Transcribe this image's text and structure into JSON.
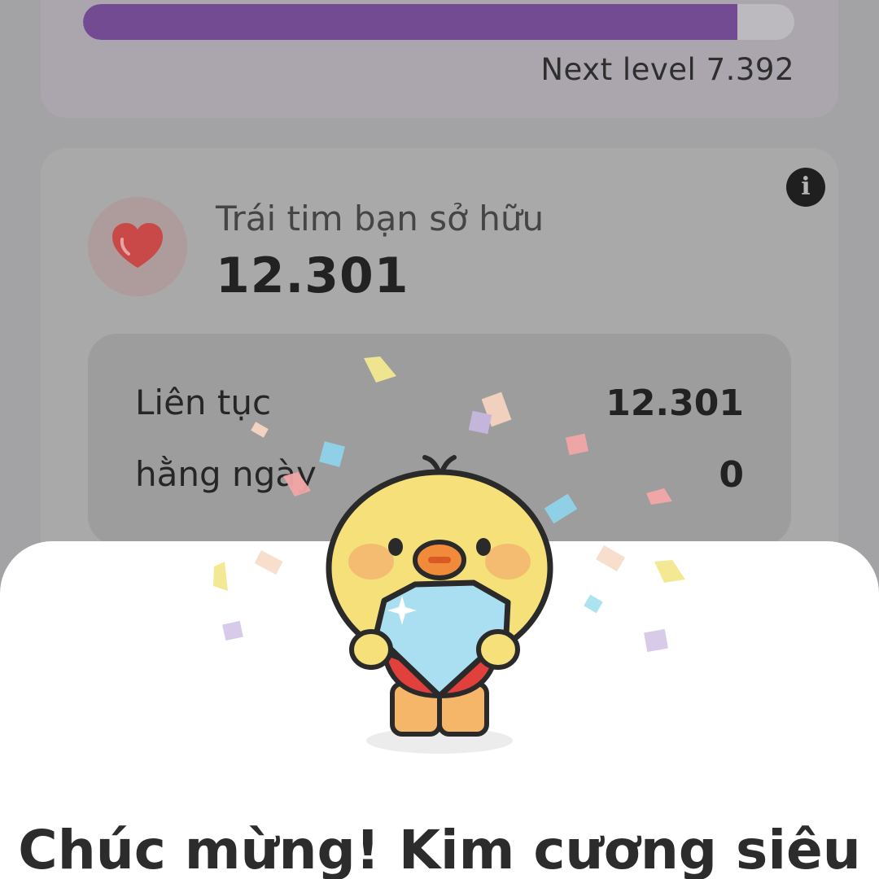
{
  "level": {
    "progress_fraction": 0.92,
    "next_level_text": "Next level 7.392",
    "fill_color": "#724b92"
  },
  "hearts": {
    "title": "Trái tim bạn sở hữu",
    "value": "12.301",
    "info_icon": "info-icon",
    "heart_icon": "heart-icon",
    "heart_color": "#c94848"
  },
  "stats": [
    {
      "label": "Liên tục",
      "value": "12.301"
    },
    {
      "label": "hằng ngày",
      "value": "0"
    }
  ],
  "sheet": {
    "title": "Chúc mừng! Kim cương siêu",
    "illustration_icon": "duck-holding-diamond-icon"
  }
}
